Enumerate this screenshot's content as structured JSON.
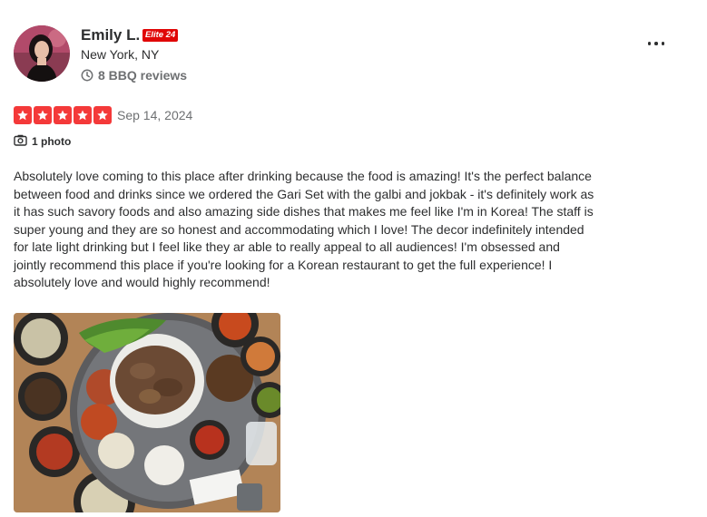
{
  "reviewer": {
    "name": "Emily L.",
    "elite_badge": "Elite 24",
    "location": "New York, NY",
    "review_count": "8 BBQ reviews",
    "avatar_icon": "profile-photo"
  },
  "review": {
    "rating": 5,
    "rating_max": 5,
    "date": "Sep 14, 2024",
    "photo_count": "1 photo",
    "text": "Absolutely love coming to this place after drinking because the food is amazing! It's the perfect balance between food and drinks since we ordered the Gari Set with the galbi and jokbak - it's definitely work as it has such savory foods and also amazing side dishes that makes me feel like I'm in Korea! The staff is super young and they are so honest and accommodating which I love! The decor indefinitely intended for late light drinking but I feel like they ar able to really appeal to all audiences! I'm obsessed and jointly recommend this place if you're looking for a Korean restaurant to get the full experience! I absolutely love and would highly recommend!"
  },
  "colors": {
    "star": "#f43939",
    "elite_badge": "#e00707",
    "text": "#2d2e2f",
    "muted": "#6e7072"
  },
  "icons": {
    "more": "more-options-icon",
    "review_count": "clock-icon",
    "photo": "camera-icon",
    "star": "star-icon"
  }
}
